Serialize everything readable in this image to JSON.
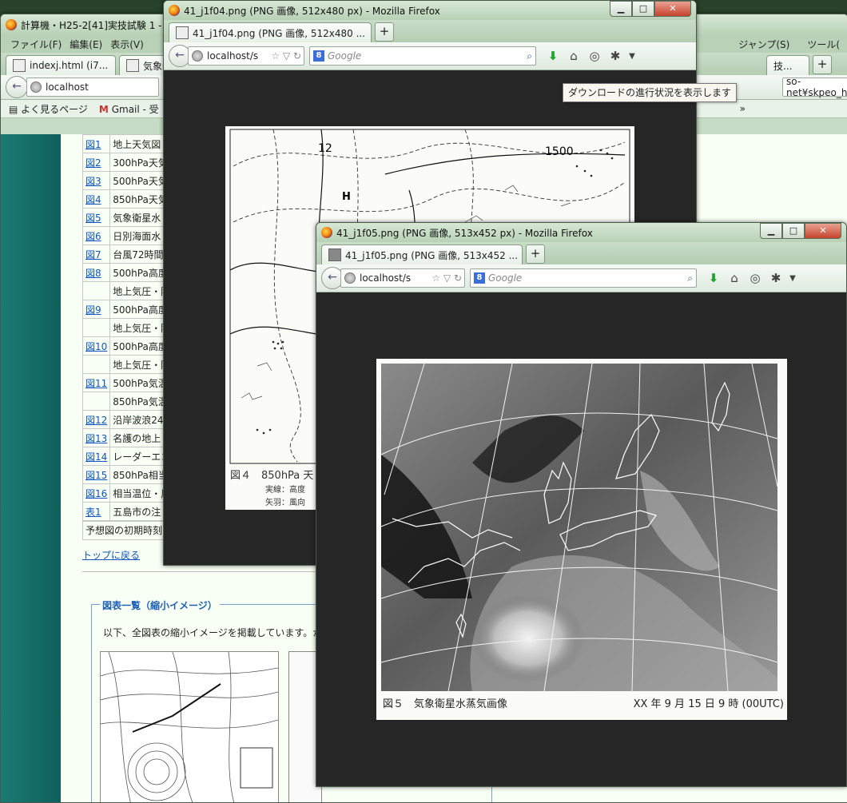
{
  "back_window": {
    "title": "計算機・H25-2[41]実技試験 1 - ",
    "menu": [
      "ファイル(F)",
      "編集(E)",
      "表示(V)"
    ],
    "tabs": [
      "indexj.html (i7...",
      "気象予報..."
    ],
    "url": "localhost",
    "bookmarks": [
      "よく見るページ",
      "Gmail - 受"
    ],
    "right_menu": [
      "ジャンプ(S)",
      "ツール("
    ],
    "right_tab": "技...",
    "right_url_fragment": "so-net¥skpeo_h_web",
    "figures": [
      {
        "no": "図1",
        "name": "地上天気図"
      },
      {
        "no": "図2",
        "name": "300hPa天気"
      },
      {
        "no": "図3",
        "name": "500hPa天気"
      },
      {
        "no": "図4",
        "name": "850hPa天気"
      },
      {
        "no": "図5",
        "name": "気象衛星水"
      },
      {
        "no": "図6",
        "name": "日別海面水"
      },
      {
        "no": "図7",
        "name": "台風72時間"
      },
      {
        "no": "図8",
        "name": "500hPa高度"
      },
      {
        "no": "",
        "name": "地上気圧・降"
      },
      {
        "no": "図9",
        "name": "500hPa高度"
      },
      {
        "no": "",
        "name": "地上気圧・降"
      },
      {
        "no": "図10",
        "name": "500hPa高度"
      },
      {
        "no": "",
        "name": "地上気圧・降"
      },
      {
        "no": "図11",
        "name": "500hPa気温"
      },
      {
        "no": "",
        "name": "850hPa気温"
      },
      {
        "no": "図12",
        "name": "沿岸波浪24"
      },
      {
        "no": "図13",
        "name": "名護の地上"
      },
      {
        "no": "図14",
        "name": "レーダーエコ"
      },
      {
        "no": "図15",
        "name": "850hPa相当"
      },
      {
        "no": "図16",
        "name": "相当温位・風"
      },
      {
        "no": "表1",
        "name": "五島市の注"
      }
    ],
    "footnote": "予想図の初期時刻",
    "top_link": "トップに戻る",
    "section_title": "図表一覧（縮小イメージ）",
    "section_text": "以下、全図表の縮小イメージを掲載しています。か"
  },
  "win_f04": {
    "title": "41_j1f04.png (PNG 画像, 512x480 px) - Mozilla Firefox",
    "tab": "41_j1f04.png (PNG 画像, 512x480 ...",
    "url": "localhost/s",
    "search_placeholder": "Google",
    "tooltip": "ダウンロードの進行状況を表示します",
    "caption": "図４　850hPa 天",
    "legend1": "実線：高度",
    "legend2": "矢羽：風向",
    "label_1500": "1500",
    "label_12": "12",
    "label_H": "H"
  },
  "win_f05": {
    "title": "41_j1f05.png (PNG 画像, 513x452 px) - Mozilla Firefox",
    "tab": "41_j1f05.png (PNG 画像, 513x452 ...",
    "url": "localhost/s",
    "search_placeholder": "Google",
    "caption_left": "図５　気象衛星水蒸気画像",
    "caption_right": "XX 年 9 月 15 日 9 時 (00UTC)"
  },
  "colors": {
    "sidebar": "#1b7b74",
    "link": "#1155bb",
    "download": "#1fa52b"
  }
}
